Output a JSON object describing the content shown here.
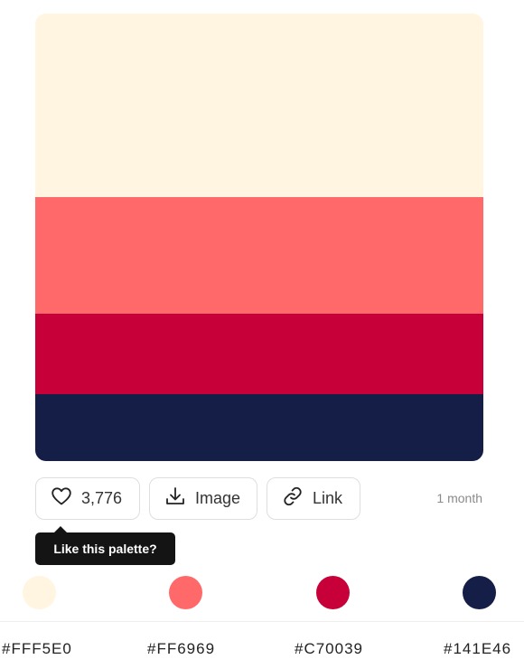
{
  "palette": {
    "colors": [
      "#FFF5E0",
      "#FF6969",
      "#C70039",
      "#141E46"
    ],
    "hex_labels": [
      "#FFF5E0",
      "#FF6969",
      "#C70039",
      "#141E46"
    ]
  },
  "actions": {
    "like_count": "3,776",
    "image_label": "Image",
    "link_label": "Link",
    "age": "1 month"
  },
  "tooltip": {
    "text": "Like this palette?"
  },
  "icons": {
    "like": "heart-icon",
    "image": "download-icon",
    "link": "link-icon"
  }
}
